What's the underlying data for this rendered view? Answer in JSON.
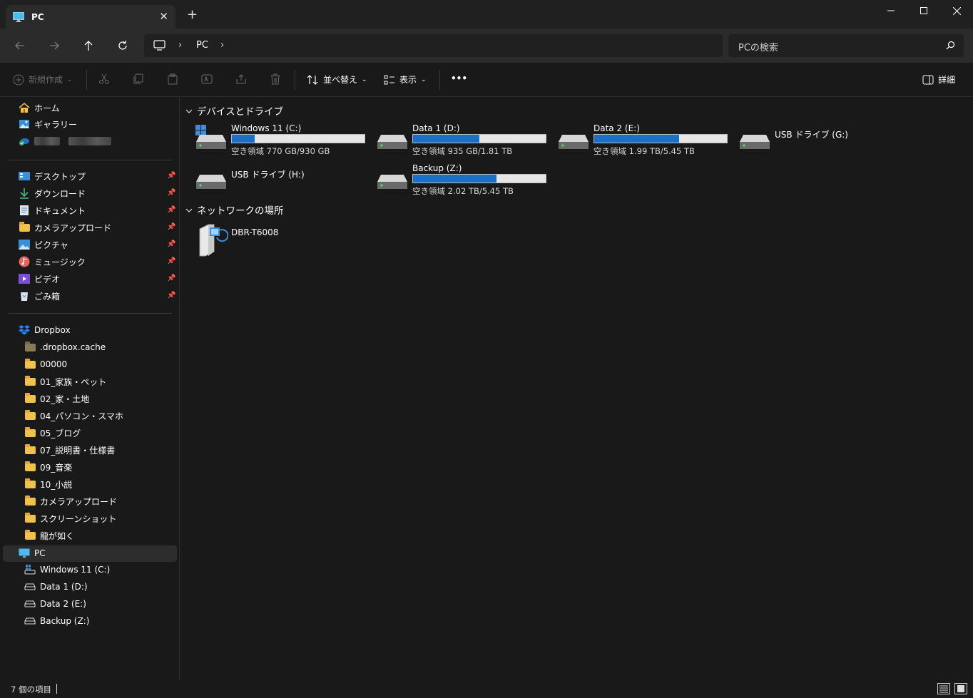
{
  "window": {
    "tab_title": "PC",
    "tab_close": "✕",
    "new_tab": "+"
  },
  "address": {
    "segment": "PC"
  },
  "search": {
    "placeholder": "PCの検索"
  },
  "toolbar": {
    "new_label": "新規作成",
    "sort_label": "並べ替え",
    "view_label": "表示",
    "more_label": "•••",
    "details_label": "詳細"
  },
  "sidebar": {
    "home": "ホーム",
    "gallery": "ギャラリー",
    "quick_access": [
      {
        "label": "デスクトップ",
        "icon": "desktop-icon"
      },
      {
        "label": "ダウンロード",
        "icon": "download-icon"
      },
      {
        "label": "ドキュメント",
        "icon": "document-icon"
      },
      {
        "label": "カメラアップロード",
        "icon": "folder-icon"
      },
      {
        "label": "ピクチャ",
        "icon": "pictures-icon"
      },
      {
        "label": "ミュージック",
        "icon": "music-icon"
      },
      {
        "label": "ビデオ",
        "icon": "video-icon"
      },
      {
        "label": "ごみ箱",
        "icon": "recycle-bin-icon"
      }
    ],
    "dropbox": "Dropbox",
    "dropbox_folders": [
      ".dropbox.cache",
      "00000",
      "01_家族・ペット",
      "02_家・土地",
      "04_パソコン・スマホ",
      "05_ブログ",
      "07_説明書・仕様書",
      "09_音楽",
      "10_小説",
      "カメラアップロード",
      "スクリーンショット",
      "龍が如く"
    ],
    "pc": "PC",
    "pc_drives": [
      "Windows 11 (C:)",
      "Data 1 (D:)",
      "Data 2 (E:)",
      "Backup (Z:)"
    ]
  },
  "main": {
    "devices_header": "デバイスとドライブ",
    "network_header": "ネットワークの場所",
    "drives": [
      {
        "name": "Windows 11 (C:)",
        "free": "空き領域 770 GB/930 GB",
        "used_fraction": 0.17
      },
      {
        "name": "Data 1 (D:)",
        "free": "空き領域 935 GB/1.81 TB",
        "used_fraction": 0.5
      },
      {
        "name": "Data 2 (E:)",
        "free": "空き領域 1.99 TB/5.45 TB",
        "used_fraction": 0.64
      },
      {
        "name": "USB ドライブ (G:)",
        "free": "",
        "used_fraction": null
      },
      {
        "name": "USB ドライブ (H:)",
        "free": "",
        "used_fraction": null
      },
      {
        "name": "Backup (Z:)",
        "free": "空き領域 2.02 TB/5.45 TB",
        "used_fraction": 0.63
      }
    ],
    "network": [
      {
        "name": "DBR-T6008"
      }
    ]
  },
  "status": {
    "item_count": "7 個の項目"
  },
  "colors": {
    "accent": "#1a6fc9",
    "background": "#191919",
    "folder": "#f0c14b"
  }
}
